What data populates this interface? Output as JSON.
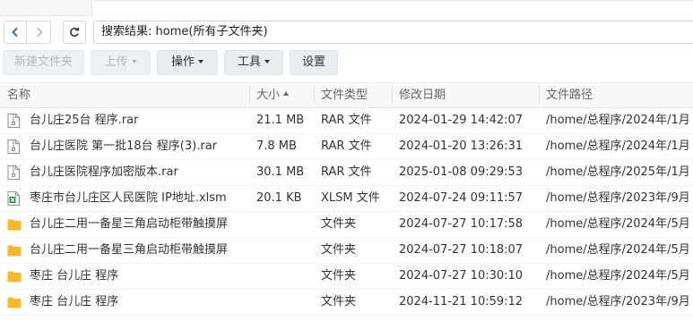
{
  "nav": {
    "search_text": "搜索结果: home(所有子文件夹)"
  },
  "toolbar": {
    "new_folder": "新建文件夹",
    "upload": "上传",
    "action": "操作",
    "tools": "工具",
    "settings": "设置"
  },
  "columns": {
    "name": "名称",
    "size": "大小",
    "type": "文件类型",
    "modified": "修改日期",
    "path": "文件路径"
  },
  "files": [
    {
      "name": "台儿庄25台 程序.rar",
      "size": "21.1 MB",
      "type": "RAR 文件",
      "modified": "2024-01-29 14:42:07",
      "path": "/home/总程序/2024年/1月",
      "icon": "archive-icon"
    },
    {
      "name": "台儿庄医院 第一批18台 程序(3).rar",
      "size": "7.8 MB",
      "type": "RAR 文件",
      "modified": "2024-01-20 13:26:31",
      "path": "/home/总程序/2024年/1月",
      "icon": "archive-icon"
    },
    {
      "name": "台儿庄医院程序加密版本.rar",
      "size": "30.1 MB",
      "type": "RAR 文件",
      "modified": "2025-01-08 09:29:53",
      "path": "/home/总程序/2025年/1月",
      "icon": "archive-icon"
    },
    {
      "name": "枣庄市台儿庄区人民医院 IP地址.xlsm",
      "size": "20.1 KB",
      "type": "XLSM 文件",
      "modified": "2024-07-24 09:11:57",
      "path": "/home/总程序/2023年/9月",
      "icon": "excel-icon"
    },
    {
      "name": "台儿庄二用一备星三角启动柜带触摸屏",
      "size": "",
      "type": "文件夹",
      "modified": "2024-07-27 10:17:58",
      "path": "/home/总程序/2024年/5月",
      "icon": "folder-icon"
    },
    {
      "name": "台儿庄二用一备星三角启动柜带触摸屏",
      "size": "",
      "type": "文件夹",
      "modified": "2024-07-27 10:18:07",
      "path": "/home/总程序/2024年/5月",
      "icon": "folder-icon"
    },
    {
      "name": "枣庄 台儿庄 程序",
      "size": "",
      "type": "文件夹",
      "modified": "2024-07-27 10:30:10",
      "path": "/home/总程序/2024年/5月",
      "icon": "folder-icon"
    },
    {
      "name": "枣庄 台儿庄 程序",
      "size": "",
      "type": "文件夹",
      "modified": "2024-11-21 10:59:12",
      "path": "/home/总程序/2023年/9月",
      "icon": "folder-icon"
    }
  ],
  "colors": {
    "folder": "#f5b82e",
    "excel": "#1e8e3e",
    "archive": "#8a8f96",
    "accent": "#2f6db5"
  }
}
